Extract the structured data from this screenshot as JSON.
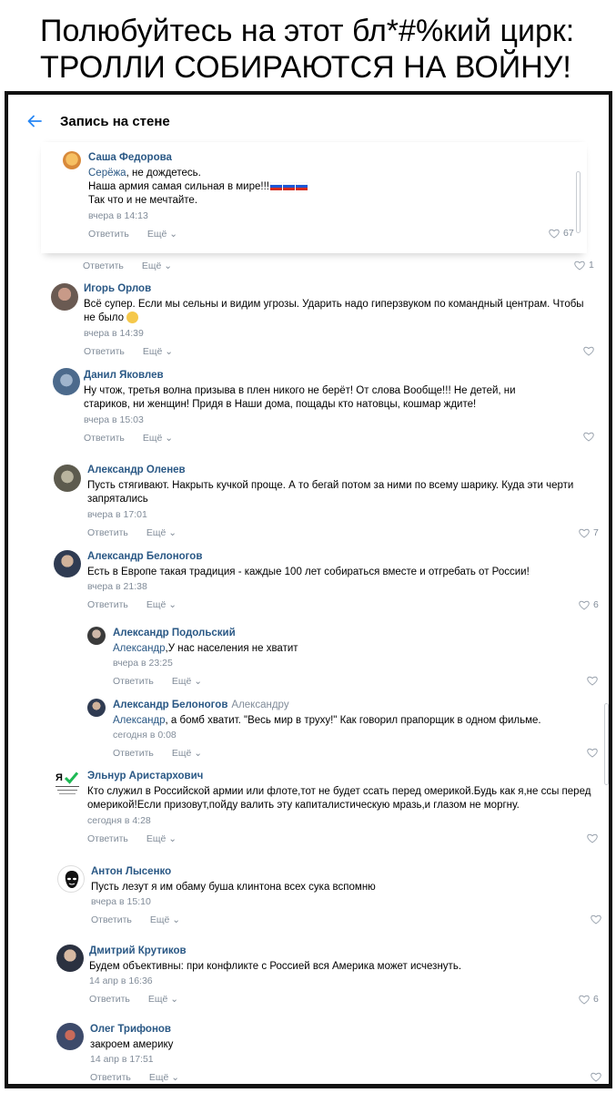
{
  "caption": {
    "line1": "Полюбуйтесь на этот бл*#%кий цирк:",
    "line2": "ТРОЛЛИ СОБИРАЮТСЯ НА ВОЙНУ!"
  },
  "header": {
    "title": "Запись на стене"
  },
  "labels": {
    "reply": "Ответить",
    "more": "Ещё"
  },
  "pinned": {
    "author": "Саша Федорова",
    "mention": "Серёжа",
    "line1_rest": ", не дождетесь.",
    "line2": "Наша армия самая сильная в мире!!!",
    "line3": "Так что и не мечтайте.",
    "time": "вчера в 14:13",
    "likes": "67"
  },
  "above_row": {
    "likes": "1"
  },
  "comments": [
    {
      "author": "Игорь Орлов",
      "text": "Всё супер. Если мы сельны и видим угрозы. Ударить надо гиперзвуком по командный центрам. Чтобы не было",
      "time": "вчера в 14:39",
      "likes": ""
    },
    {
      "author": "Данил Яковлев",
      "text": "Ну чтож, третья волна призыва в плен никого не берёт! От слова Вообще!!! Не детей, ни стариков, ни женщин! Придя в Наши дома, пощады кто натовцы, кошмар ждите!",
      "time": "вчера в 15:03",
      "likes": ""
    },
    {
      "author": "Александр Оленев",
      "text": "Пусть стягивают. Накрыть кучкой проще. А то бегай потом за ними по всему шарику. Куда эти черти запрятались",
      "time": "вчера в 17:01",
      "likes": "7"
    },
    {
      "author": "Александр Белоногов",
      "text": "Есть в Европе такая традиция - каждые 100 лет собираться вместе и отгребать от России!",
      "time": "вчера в 21:38",
      "likes": "6"
    },
    {
      "author": "Александр Подольский",
      "mention": "Александр",
      "text": ",У нас населения не хватит",
      "time": "вчера в 23:25",
      "likes": ""
    },
    {
      "author": "Александр Белоногов",
      "reply_to": "Александру",
      "mention": "Александр",
      "text": ", а бомб хватит. \"Весь мир в труху!\" Как говорил прапорщик в одном фильме.",
      "time": "сегодня в 0:08",
      "likes": ""
    },
    {
      "author": "Эльнур Аристархович",
      "avatar_text": "Я",
      "text": "Кто служил в Российской армии или флоте,тот не будет ссать перед омерикой.Будь как я,не ссы перед омерикой!Если призовут,пойду валить эту капиталистическую мразь,и глазом не моргну.",
      "time": "сегодня в 4:28",
      "likes": ""
    },
    {
      "author": "Антон Лысенко",
      "text": "Пусть лезут я им обаму буша клинтона всех сука вспомню",
      "time": "вчера в 15:10",
      "likes": ""
    },
    {
      "author": "Дмитрий Крутиков",
      "text": "Будем объективны: при конфликте с Россией вся Америка может исчезнуть.",
      "time": "14 апр в 16:36",
      "likes": "6"
    },
    {
      "author": "Олег Трифонов",
      "text": "закроем америку",
      "time": "14 апр в 17:51",
      "likes": ""
    }
  ],
  "colors": {
    "link": "#2a5885",
    "meta": "#818c99",
    "accent": "#2787f5"
  }
}
